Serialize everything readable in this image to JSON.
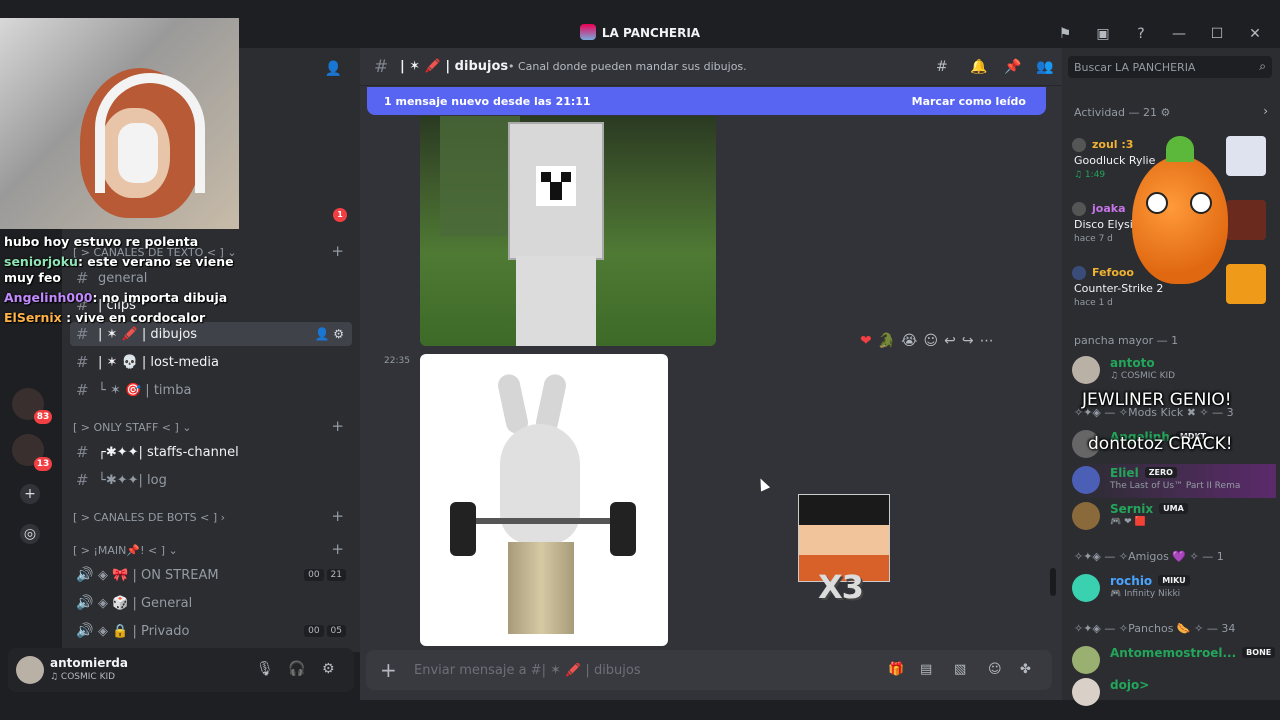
{
  "window": {
    "title": "LA PANCHERIA"
  },
  "titlebar_icons": [
    "flag-icon",
    "inbox-icon",
    "help-icon",
    "minimize-icon",
    "maximize-icon",
    "close-icon"
  ],
  "guild_badges": {
    "dm_badge": "1",
    "g1": "83",
    "g2": "13"
  },
  "stream_chat": [
    {
      "user": "",
      "text": "hubo hoy estuvo re polenta"
    },
    {
      "user": "seniorjoku",
      "text": ": este verano se viene muy feo"
    },
    {
      "user": "Angelinh000",
      "text": ": no importa dibuja"
    },
    {
      "user": "ElSernix",
      "text": " : vive en cordocalor"
    }
  ],
  "sidebar": {
    "cat_texto": "[ > CANALES DE TEXTO < ]",
    "general": "general",
    "clips": "| clips",
    "dibujos": "| ✶ 🖍️ | dibujos",
    "lost_media": "| ✶ 💀 | lost-media",
    "timba": "└ ✶ 🎯 | timba",
    "cat_staff": "[ > ONLY STAFF < ]",
    "staffs": "┌✱✦✦| staffs-channel",
    "log": "└✱✦✦| log",
    "cat_bots": "[ > CANALES DE BOTS < ]",
    "cat_main": "[ > ¡MAIN📌! < ]",
    "on_stream": "◈ 🎀 | ON STREAM",
    "on_stream_a": "00",
    "on_stream_b": "21",
    "general_vc": "◈ 🎲 | General",
    "privado": "◈ 🔒 | Privado",
    "privado_a": "00",
    "privado_b": "05"
  },
  "user": {
    "name": "antomierda",
    "status": "♫ COSMIC KID"
  },
  "channel": {
    "name": "| ✶ 🖍️ | dibujos",
    "topic": "• Canal donde pueden mandar sus dibujos."
  },
  "new_messages": {
    "text": "1 mensaje nuevo desde las 21:11",
    "action": "Marcar como leído"
  },
  "message": {
    "time": "22:35"
  },
  "image_text": {
    "goku": "X3"
  },
  "composer": {
    "placeholder": "Enviar mensaje a #| ✶ 🖍️ | dibujos"
  },
  "right": {
    "search_placeholder": "Buscar LA PANCHERIA",
    "activity_header": "Actividad — 21 ⚙",
    "activities": [
      {
        "name": "zoul :3",
        "game": "Goodluck Rylie",
        "time": "♫ 1:49"
      },
      {
        "name": "joaka",
        "game": "Disco Elysiu",
        "time": "hace 7 d"
      },
      {
        "name": "Fefooo",
        "game": "Counter-Strike 2",
        "time": "hace 1 d"
      }
    ],
    "role1": "pancha mayor — 1",
    "members1": [
      {
        "name": "antoto",
        "status": "♫ COSMIC KID"
      }
    ],
    "role2": "✧✦◈ — ✧Mods Kick ✖ ✧ — 3",
    "members2": [
      {
        "name": "Angelinh",
        "tag": "MDKT",
        "status": ""
      },
      {
        "name": "Eliel",
        "tag": "ZERO",
        "status": "The Last of Us™ Part II Rema"
      },
      {
        "name": "Sernix",
        "tag": "UMA",
        "status": "🎮 ❤ 🟥"
      }
    ],
    "role3": "✧✦◈ — ✧Amigos 💜 ✧ — 1",
    "members3": [
      {
        "name": "rochio",
        "tag": "MIKU",
        "status": "🎮 Infinity Nikki"
      }
    ],
    "role4": "✧✦◈ — ✧Panchos 🌭 ✧ — 34",
    "members4": [
      {
        "name": "Antomemostroel...",
        "tag": "BONE",
        "status": ""
      },
      {
        "name": "dojo>",
        "status": ""
      }
    ]
  },
  "overlays": {
    "o1": "JEWLINER GENIO!",
    "o2": "dontotoz CRACK!"
  },
  "colors": {
    "accent": "#5865f2",
    "bg": "#313338",
    "sidebar": "#2b2d31",
    "dark": "#1e1f22"
  }
}
